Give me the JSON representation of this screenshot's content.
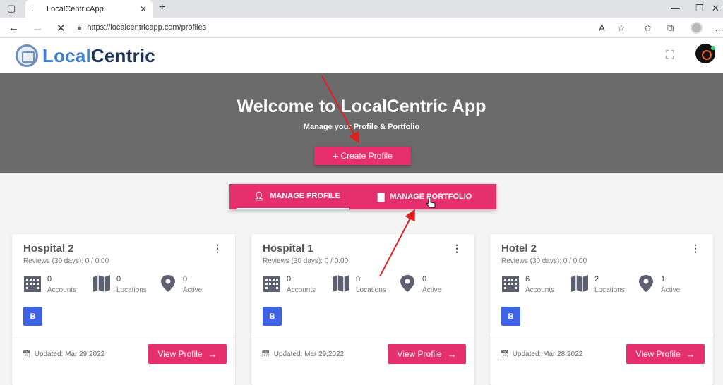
{
  "browser": {
    "tab_title": "LocalCentricApp",
    "url": "https://localcentricapp.com/profiles"
  },
  "app": {
    "logo_part1": "Local",
    "logo_part2": "Centric"
  },
  "hero": {
    "title": "Welcome to LocalCentric App",
    "subtitle": "Manage your Profile & Portfolio",
    "create_button": "Create Profile"
  },
  "tabs": {
    "manage_profile": "MANAGE PROFILE",
    "manage_portfolio": "MANAGE PORTFOLIO"
  },
  "cards": [
    {
      "name": "Hospital 2",
      "reviews": "Reviews (30 days): 0 / 0.00",
      "accounts": "0",
      "accounts_label": "Accounts",
      "locations": "0",
      "locations_label": "Locations",
      "active": "0",
      "active_label": "Active",
      "badge": "B",
      "updated": "Updated: Mar 29,2022",
      "button": "View Profile"
    },
    {
      "name": "Hospital 1",
      "reviews": "Reviews (30 days): 0 / 0.00",
      "accounts": "0",
      "accounts_label": "Accounts",
      "locations": "0",
      "locations_label": "Locations",
      "active": "0",
      "active_label": "Active",
      "badge": "B",
      "updated": "Updated: Mar 29,2022",
      "button": "View Profile"
    },
    {
      "name": "Hotel 2",
      "reviews": "Reviews (30 days): 0 / 0.00",
      "accounts": "6",
      "accounts_label": "Accounts",
      "locations": "2",
      "locations_label": "Locations",
      "active": "1",
      "active_label": "Active",
      "badge": "B",
      "updated": "Updated: Mar 28,2022",
      "button": "View Profile"
    }
  ],
  "colors": {
    "accent": "#e6306e",
    "hero_bg": "#6b6b6b",
    "badge": "#3e63e3",
    "annotation": "#e02020"
  }
}
